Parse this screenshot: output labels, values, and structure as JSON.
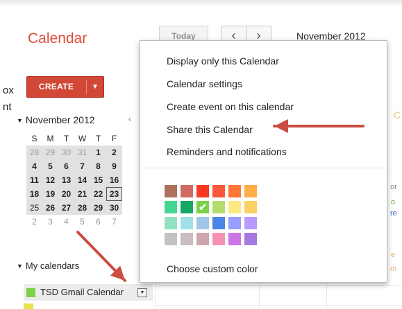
{
  "header": {
    "title": "Calendar",
    "today_label": "Today",
    "prev_icon": "‹",
    "next_icon": "›",
    "period": "November 2012"
  },
  "background_fragments": {
    "left_line1": "ox",
    "left_line2": "nt"
  },
  "create_button": {
    "label": "CREATE",
    "caret": "▼"
  },
  "mini_calendar": {
    "month": "November 2012",
    "collapse_icon": "▼",
    "prev_icon": "‹",
    "weekdays": [
      "S",
      "M",
      "T",
      "W",
      "T",
      "F"
    ],
    "weeks": [
      [
        "28",
        "29",
        "30",
        "31",
        "1",
        "2"
      ],
      [
        "4",
        "5",
        "6",
        "7",
        "8",
        "9"
      ],
      [
        "11",
        "12",
        "13",
        "14",
        "15",
        "16"
      ],
      [
        "18",
        "19",
        "20",
        "21",
        "22",
        "23"
      ],
      [
        "25",
        "26",
        "27",
        "28",
        "29",
        "30"
      ],
      [
        "2",
        "3",
        "4",
        "5",
        "6",
        "7"
      ]
    ]
  },
  "my_calendars": {
    "label": "My calendars",
    "collapse_icon": "▼",
    "items": [
      {
        "name": "TSD Gmail Calendar",
        "color": "#7bd148"
      }
    ],
    "dropdown_icon": "▼"
  },
  "edge_text": {
    "c": "C",
    "or": "or",
    "o": "o",
    "re": "re",
    "e": "e",
    "m": "m"
  },
  "menu": {
    "items": [
      "Display only this Calendar",
      "Calendar settings",
      "Create event on this calendar",
      "Share this Calendar",
      "Reminders and notifications"
    ],
    "custom_color": "Choose custom color",
    "selected_mark": "✔",
    "palette": [
      [
        "#ac725e",
        "#d06b64",
        "#f83a22",
        "#fa573c",
        "#ff7537",
        "#ffad46"
      ],
      [
        "#42d692",
        "#16a765",
        "#7bd148",
        "#b3dc6c",
        "#fbe983",
        "#fad165"
      ],
      [
        "#92e1c0",
        "#9fe1e7",
        "#9fc6e7",
        "#4986e7",
        "#9a9cff",
        "#b99aff"
      ],
      [
        "#c2c2c2",
        "#cabdbf",
        "#cca6ac",
        "#f691b2",
        "#cd74e6",
        "#a47ae2"
      ]
    ],
    "selected_color": "#7bd148"
  },
  "annotation_color": "#cc4c40"
}
